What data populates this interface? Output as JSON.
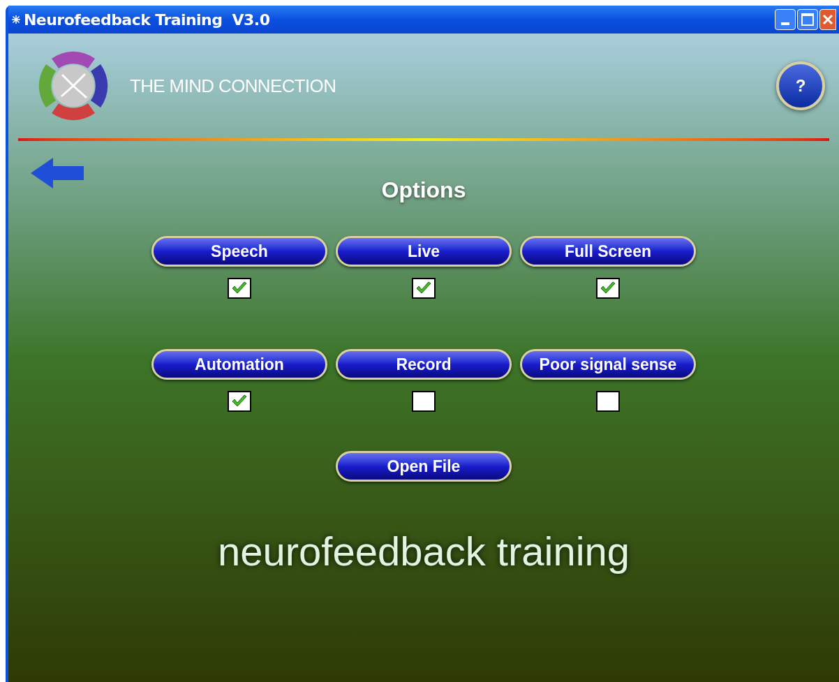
{
  "window": {
    "title": "Neurofeedback Training  V3.0"
  },
  "header": {
    "brand": "THE MIND CONNECTION",
    "help": "?"
  },
  "page_title": "Options",
  "options": [
    {
      "label": "Speech",
      "checked": true
    },
    {
      "label": "Live",
      "checked": true
    },
    {
      "label": "Full Screen",
      "checked": true
    },
    {
      "label": "Automation",
      "checked": true
    },
    {
      "label": "Record",
      "checked": false
    },
    {
      "label": "Poor signal sense",
      "checked": false
    }
  ],
  "open_file": "Open File",
  "footer_text": "neurofeedback training"
}
